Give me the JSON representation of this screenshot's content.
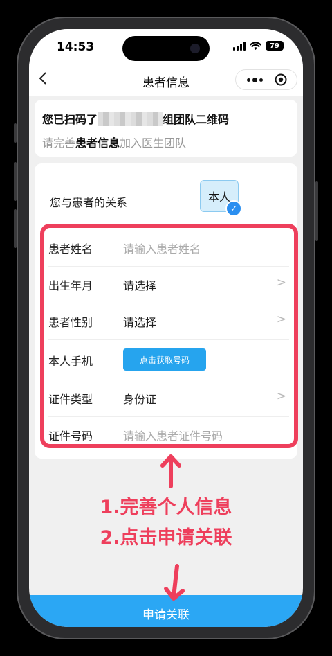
{
  "status_bar": {
    "time": "14:53",
    "battery": "79"
  },
  "nav": {
    "title": "患者信息"
  },
  "scan": {
    "prefix": "您已扫码了",
    "suffix": "组团队二维码",
    "hint_before": "请完善",
    "hint_bold": "患者信息",
    "hint_after": "加入医生团队"
  },
  "relation": {
    "label": "您与患者的关系",
    "selected": "本人"
  },
  "form": {
    "name": {
      "label": "患者姓名",
      "placeholder": "请输入患者姓名"
    },
    "birth": {
      "label": "出生年月",
      "value": "请选择"
    },
    "gender": {
      "label": "患者性别",
      "value": "请选择"
    },
    "phone": {
      "label": "本人手机",
      "button": "点击获取号码"
    },
    "id_type": {
      "label": "证件类型",
      "value": "身份证"
    },
    "id_number": {
      "label": "证件号码",
      "placeholder": "请输入患者证件号码"
    },
    "chevron": ">"
  },
  "annotation": {
    "line1": "1.完善个人信息",
    "line2": "2.点击申请关联",
    "color": "#ee3f5c"
  },
  "submit": {
    "label": "申请关联",
    "color": "#2ba7f4"
  }
}
